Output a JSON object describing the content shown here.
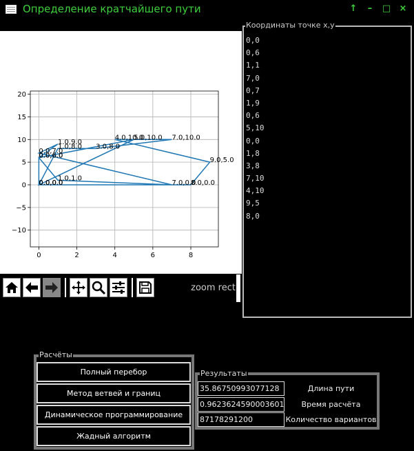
{
  "window": {
    "title": "Определение кратчайшего пути",
    "controls": [
      "pin-icon",
      "minimize-icon",
      "maximize-icon",
      "close-icon"
    ]
  },
  "chart_data": {
    "type": "line",
    "xlim": [
      -0.45,
      9.45
    ],
    "ylim": [
      -13.7,
      20.7
    ],
    "xticks": [
      0,
      2,
      4,
      6,
      8
    ],
    "yticks": [
      20,
      15,
      10,
      5,
      0,
      -5,
      -10
    ],
    "grid": true,
    "line_color": "#1f77b4",
    "series": [
      {
        "x": [
          0,
          0,
          1,
          7,
          0,
          1,
          0,
          5,
          0,
          1,
          3,
          7,
          4,
          9,
          8,
          0
        ],
        "y": [
          0,
          6,
          1,
          0,
          7,
          9,
          6,
          10,
          0,
          8,
          8,
          10,
          10,
          5,
          0,
          0
        ]
      }
    ],
    "point_labels": [
      {
        "text": "0.0,0.0",
        "x": 0,
        "y": 0
      },
      {
        "text": "0.0,6.0",
        "x": 0,
        "y": 6
      },
      {
        "text": "1.0,1.0",
        "x": 1,
        "y": 1
      },
      {
        "text": "7.0,0.0",
        "x": 7,
        "y": 0
      },
      {
        "text": "0.0,7.0",
        "x": 0,
        "y": 7
      },
      {
        "text": "1.0,9.0",
        "x": 1,
        "y": 9
      },
      {
        "text": "0.0,6.0",
        "x": 0,
        "y": 6
      },
      {
        "text": "5.0,10.0",
        "x": 5,
        "y": 10
      },
      {
        "text": "0.0,0.0",
        "x": 0,
        "y": 0
      },
      {
        "text": "1.0,8.0",
        "x": 1,
        "y": 8
      },
      {
        "text": "3.0,8.0",
        "x": 3,
        "y": 8
      },
      {
        "text": "7.0,10.0",
        "x": 7,
        "y": 10
      },
      {
        "text": "4.0,10.0",
        "x": 4,
        "y": 10
      },
      {
        "text": "9.0,5.0",
        "x": 9,
        "y": 5
      },
      {
        "text": "8.0,0.0",
        "x": 8,
        "y": 0
      },
      {
        "text": "0.0,0.0",
        "x": 0,
        "y": 0
      }
    ]
  },
  "toolbar": {
    "buttons": [
      "home-icon",
      "back-icon",
      "forward-icon",
      "pan-icon",
      "zoom-icon",
      "configure-subplots-icon",
      "save-icon"
    ],
    "message": "zoom rect"
  },
  "coordinates_panel": {
    "title": "Координаты точке x,y",
    "items": [
      "0,0",
      "0,6",
      "1,1",
      "7,0",
      "0,7",
      "1,9",
      "0,6",
      "5,10",
      "0,0",
      "1,8",
      "3,8",
      "7,10",
      "4,10",
      "9,5",
      "8,0"
    ]
  },
  "calculations": {
    "title": "Расчёты",
    "buttons": [
      "Полный перебор",
      "Метод ветвей и границ",
      "Динамическое программирование",
      "Жадный алгоритм"
    ]
  },
  "results": {
    "title": "Результаты",
    "rows": [
      {
        "value": "35.86750993077128",
        "label": "Длина пути"
      },
      {
        "value": "0.9623624590003601",
        "label": "Время расчёта"
      },
      {
        "value": "87178291200",
        "label": "Количество вариантов"
      }
    ]
  }
}
